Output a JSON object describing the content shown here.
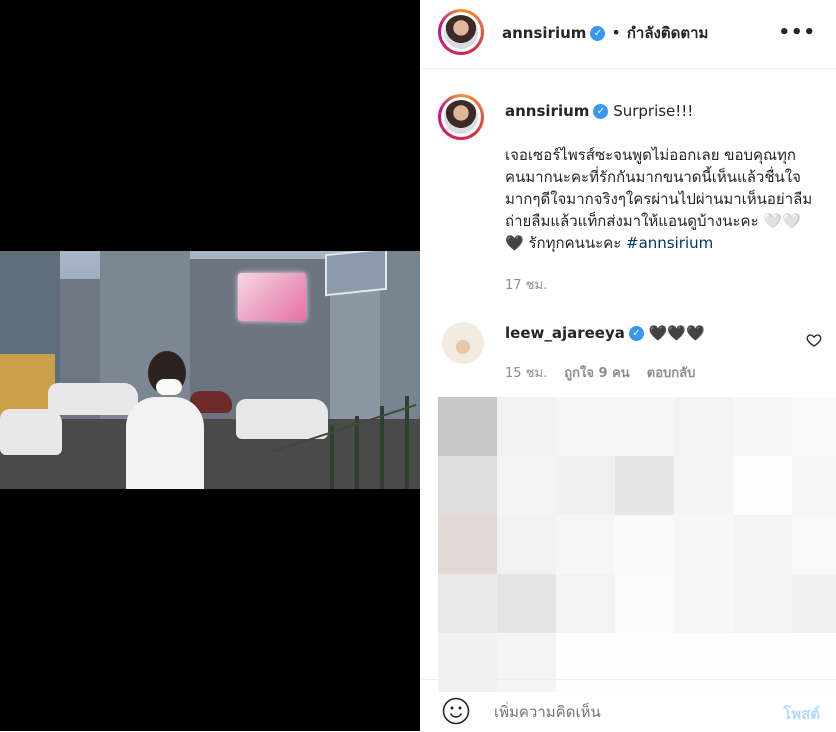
{
  "post": {
    "username": "annsirium",
    "follow_status": "กำลังติดตาม",
    "dot": "•",
    "more_label": "•••",
    "caption_title": "Surprise!!!",
    "caption_body": "เจอเซอร์ไพรส์ซะจนพูดไม่ออกเลย ขอบคุณทุกคนมากนะคะที่รักกันมากขนาดนี้เห็นแล้วชื่นใจมากๆดีใจมากจริงๆใครผ่านไปผ่านมาเห็นอย่าลืมถ่ายลืมแล้วแท็กส่งมาให้แอนดูบ้างนะคะ ",
    "caption_emoji": "🤍🤍🖤",
    "caption_tail": " รักทุกคนนะคะ ",
    "hashtag": "#annsirium",
    "time": "17 ชม."
  },
  "comment": {
    "username": "leew_ajareeya",
    "text": "🖤🖤🖤",
    "time": "15 ชม.",
    "likes": "ถูกใจ 9 คน",
    "reply": "ตอบกลับ"
  },
  "footer": {
    "placeholder": "เพิ่มความคิดเห็น",
    "post_label": "โพสต์"
  },
  "icons": {
    "verified": "verified-badge-icon",
    "heart": "heart-outline-icon",
    "emoji": "smile-icon",
    "more": "more-options-icon"
  },
  "colors": {
    "verified": "#3897f0",
    "hashtag": "#00376b",
    "post_button": "#b3dbff",
    "muted": "#8e8e8e"
  }
}
